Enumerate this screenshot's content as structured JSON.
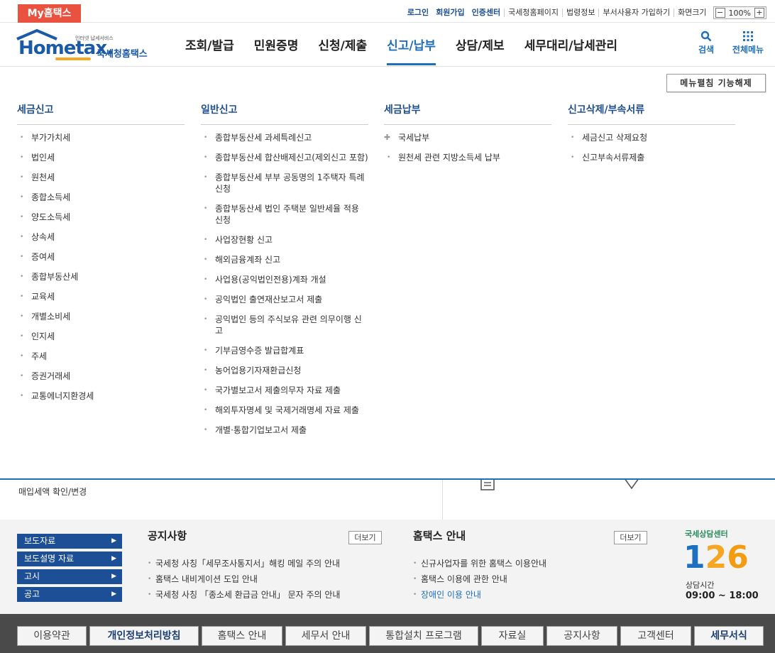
{
  "util": {
    "my_hometax": "My홈택스",
    "links": [
      "로그인",
      "회원가입",
      "인증센터",
      "국세청홈페이지",
      "법령정보",
      "부서사용자 가입하기",
      "화면크기"
    ],
    "zoom_minus": "−",
    "zoom_value": "100%",
    "zoom_plus": "+"
  },
  "header": {
    "logo_text": "Hometax.",
    "logo_small": "인터넷 납세서비스",
    "logo_korean": "국세청홈택스",
    "nav": [
      "조회/발급",
      "민원증명",
      "신청/제출",
      "신고/납부",
      "상담/제보",
      "세무대리/납세관리"
    ],
    "active_nav": "신고/납부",
    "search_label": "검색",
    "all_menu_label": "전체메뉴"
  },
  "mega": {
    "fold_button": "메뉴펼침 기능해제",
    "columns": [
      {
        "title": "세금신고",
        "items": [
          "부가가치세",
          "법인세",
          "원천세",
          "종합소득세",
          "양도소득세",
          "상속세",
          "증여세",
          "종합부동산세",
          "교육세",
          "개별소비세",
          "인지세",
          "주세",
          "증권거래세",
          "교통에너지환경세"
        ]
      },
      {
        "title": "일반신고",
        "items": [
          "종합부동산세 과세특례신고",
          "종합부동산세 합산배제신고(제외신고 포함)",
          "종합부동산세 부부 공동명의 1주택자 특례 신청",
          "종합부동산세 법인 주택분 일반세율 적용 신청",
          "사업장현황 신고",
          "해외금융계좌 신고",
          "사업용(공익법인전용)계좌 개설",
          "공익법인 출연재산보고서 제출",
          "공익법인 등의 주식보유 관련 의무이행 신고",
          "기부금영수증 발급합계표",
          "농어업용기자재환급신청",
          "국가별보고서 제출의무자 자료 제출",
          "해외투자명세 및 국제거래명세 자료 제출",
          "개별·통합기업보고서 제출"
        ]
      },
      {
        "title": "세금납부",
        "items": [
          "국세납부",
          "원천세 관련 지방소득세 납부"
        ]
      },
      {
        "title": "신고삭제/부속서류",
        "items": [
          "세금신고 삭제요청",
          "신고부속서류제출"
        ]
      }
    ]
  },
  "behind": {
    "left_text": "매입세액 확인/변경"
  },
  "notice": {
    "side_buttons": [
      "보도자료",
      "보도설명 자료",
      "고시",
      "공고"
    ],
    "notices_title": "공지사항",
    "notices_more": "더보기",
    "notices": [
      "국세청 사칭「세무조사통지서」해킹 메일 주의 안내",
      "홈택스 내비게이션 도입 안내",
      "국세청 사칭 「종소세 환급금 안내」 문자 주의 안내"
    ],
    "guide_title": "홈택스 안내",
    "guide_more": "더보기",
    "guide": [
      "신규사업자를 위한 홈택스 이용안내",
      "홈택스 이용에 관한 안내",
      "장애인 이용 안내"
    ],
    "center_title": "국세상담센터",
    "center_number": [
      "1",
      "2",
      "6"
    ],
    "center_hours_label": "상담시간",
    "center_hours": "09:00 ~ 18:00"
  },
  "footer": {
    "links": [
      "이용약관",
      "개인정보처리방침",
      "홈택스 안내",
      "세무서 안내",
      "통합설치 프로그램",
      "자료실",
      "공지사항",
      "고객센터",
      "세무서식"
    ]
  },
  "colors": {
    "brand_blue": "#1f6fb8",
    "dark_blue": "#1d4f96",
    "my_red": "#e9523f",
    "footer_bg": "#4a4a4a"
  }
}
